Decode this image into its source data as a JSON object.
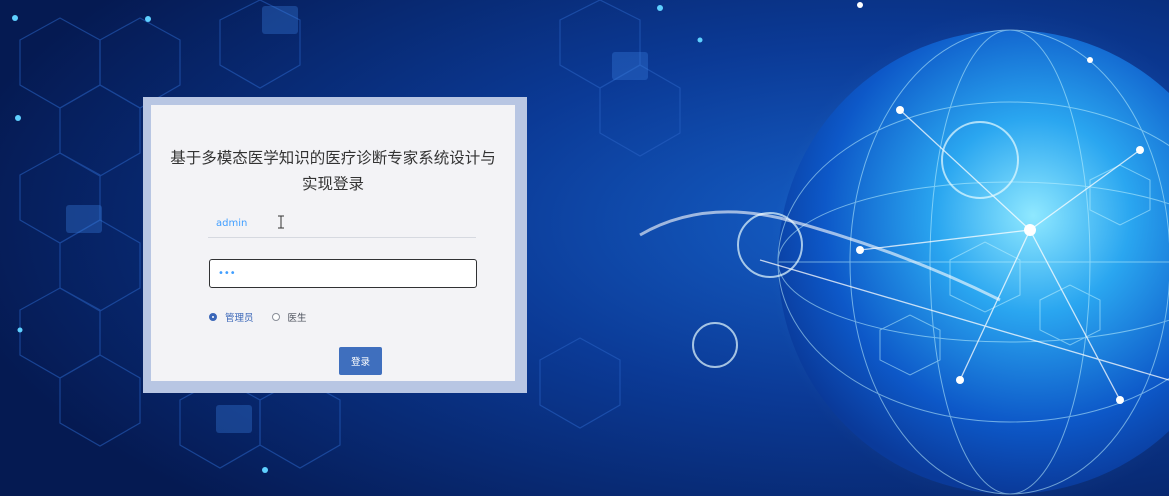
{
  "login": {
    "title": "基于多模态医学知识的医疗诊断专家系统设计与实现登录",
    "username_value": "admin",
    "password_value": "•••",
    "roles": [
      {
        "label": "管理员",
        "selected": true
      },
      {
        "label": "医生",
        "selected": false
      }
    ],
    "submit_label": "登录"
  },
  "colors": {
    "accent": "#3f6fbe",
    "background_dark": "#06205a",
    "globe_glow": "#4fc8ff"
  }
}
